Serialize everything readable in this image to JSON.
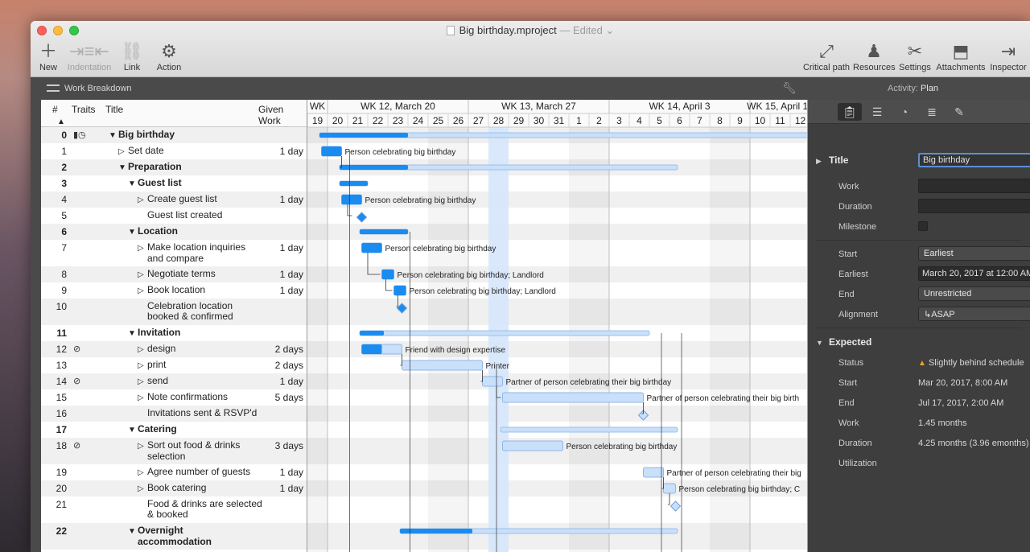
{
  "window": {
    "title": "Big birthday.mproject",
    "status": "— Edited"
  },
  "toolbar": {
    "left": [
      {
        "label": "New",
        "icon": "plus-icon"
      },
      {
        "label": "Indentation",
        "icon": "indentation-icon"
      },
      {
        "label": "Link",
        "icon": "link-icon"
      },
      {
        "label": "Action",
        "icon": "gear-icon"
      }
    ],
    "right": [
      {
        "label": "Critical path",
        "icon": "critical-path-icon"
      },
      {
        "label": "Resources",
        "icon": "resources-icon"
      },
      {
        "label": "Settings",
        "icon": "settings-icon"
      },
      {
        "label": "Attachments",
        "icon": "attachments-icon"
      },
      {
        "label": "Inspector",
        "icon": "inspector-icon"
      }
    ]
  },
  "subbar": {
    "view_label": "Work Breakdown",
    "activity_label": "Activity:",
    "activity_value": "Plan"
  },
  "outline": {
    "columns": {
      "num": "#",
      "traits": "Traits",
      "title": "Title",
      "work": "Given Work"
    },
    "rows": [
      {
        "num": "0",
        "title": "Big birthday",
        "work": "",
        "level": 0,
        "bold": true,
        "tri": "▼",
        "trait": "▮◷"
      },
      {
        "num": "1",
        "title": "Set date",
        "work": "1 day",
        "level": 1,
        "bold": false,
        "tri": "▷",
        "trait": ""
      },
      {
        "num": "2",
        "title": "Preparation",
        "work": "",
        "level": 1,
        "bold": true,
        "tri": "▼",
        "trait": ""
      },
      {
        "num": "3",
        "title": "Guest list",
        "work": "",
        "level": 2,
        "bold": true,
        "tri": "▼",
        "trait": ""
      },
      {
        "num": "4",
        "title": "Create guest list",
        "work": "1 day",
        "level": 3,
        "bold": false,
        "tri": "▷",
        "trait": ""
      },
      {
        "num": "5",
        "title": "Guest list created",
        "work": "",
        "level": 3,
        "bold": false,
        "tri": "",
        "trait": ""
      },
      {
        "num": "6",
        "title": "Location",
        "work": "",
        "level": 2,
        "bold": true,
        "tri": "▼",
        "trait": ""
      },
      {
        "num": "7",
        "title": "Make location inquiries",
        "title2": "and compare",
        "work": "1 day",
        "level": 3,
        "bold": false,
        "tri": "▷",
        "trait": ""
      },
      {
        "num": "8",
        "title": "Negotiate terms",
        "work": "1 day",
        "level": 3,
        "bold": false,
        "tri": "▷",
        "trait": ""
      },
      {
        "num": "9",
        "title": "Book location",
        "work": "1 day",
        "level": 3,
        "bold": false,
        "tri": "▷",
        "trait": ""
      },
      {
        "num": "10",
        "title": "Celebration location",
        "title2": "booked & confirmed",
        "work": "",
        "level": 3,
        "bold": false,
        "tri": "",
        "trait": ""
      },
      {
        "num": "11",
        "title": "Invitation",
        "work": "",
        "level": 2,
        "bold": true,
        "tri": "▼",
        "trait": ""
      },
      {
        "num": "12",
        "title": "design",
        "work": "2 days",
        "level": 3,
        "bold": false,
        "tri": "▷",
        "trait": "⊘"
      },
      {
        "num": "13",
        "title": "print",
        "work": "2 days",
        "level": 3,
        "bold": false,
        "tri": "▷",
        "trait": ""
      },
      {
        "num": "14",
        "title": "send",
        "work": "1 day",
        "level": 3,
        "bold": false,
        "tri": "▷",
        "trait": "⊘"
      },
      {
        "num": "15",
        "title": "Note confirmations",
        "work": "5 days",
        "level": 3,
        "bold": false,
        "tri": "▷",
        "trait": ""
      },
      {
        "num": "16",
        "title": "Invitations sent & RSVP'd",
        "work": "",
        "level": 3,
        "bold": false,
        "tri": "",
        "trait": ""
      },
      {
        "num": "17",
        "title": "Catering",
        "work": "",
        "level": 2,
        "bold": true,
        "tri": "▼",
        "trait": ""
      },
      {
        "num": "18",
        "title": "Sort out food & drinks",
        "title2": "selection",
        "work": "3 days",
        "level": 3,
        "bold": false,
        "tri": "▷",
        "trait": "⊘"
      },
      {
        "num": "19",
        "title": "Agree number of guests",
        "work": "1 day",
        "level": 3,
        "bold": false,
        "tri": "▷",
        "trait": ""
      },
      {
        "num": "20",
        "title": "Book catering",
        "work": "1 day",
        "level": 3,
        "bold": false,
        "tri": "▷",
        "trait": ""
      },
      {
        "num": "21",
        "title": "Food & drinks are selected",
        "title2": "& booked",
        "work": "",
        "level": 3,
        "bold": false,
        "tri": "",
        "trait": ""
      },
      {
        "num": "22",
        "title": "Overnight",
        "title2": "accommodation",
        "work": "",
        "level": 2,
        "bold": true,
        "tri": "▼",
        "trait": ""
      }
    ]
  },
  "gantt": {
    "weeks": [
      "WK",
      "WK 12, March 20",
      "WK 13, March 27",
      "WK 14, April 3",
      "WK 15, April 10"
    ],
    "days": [
      "19",
      "20",
      "21",
      "22",
      "23",
      "24",
      "25",
      "26",
      "27",
      "28",
      "29",
      "30",
      "31",
      "1",
      "2",
      "3",
      "4",
      "5",
      "6",
      "7",
      "8",
      "9",
      "10",
      "11",
      "12"
    ],
    "labels": [
      "Person celebrating big birthday",
      "Person celebrating big birthday",
      "Person celebrating big birthday",
      "Person celebrating big birthday; Landlord",
      "Person celebrating big birthday; Landlord",
      "Friend with design expertise",
      "Printer",
      "Partner of person celebrating their big birthday",
      "Partner of person celebrating their big birth",
      "Person celebrating big birthday",
      "Partner of person celebrating their big",
      "Person celebrating big birthday; C"
    ]
  },
  "inspector": {
    "title_label": "Title",
    "title_value": "Big birthday",
    "work_label": "Work",
    "duration_label": "Duration",
    "milestone_label": "Milestone",
    "start_label": "Start",
    "start_value": "Earliest",
    "earliest_label": "Earliest",
    "earliest_value": "March 20, 2017 at 12:00 AM",
    "end_label": "End",
    "end_value": "Unrestricted",
    "alignment_label": "Alignment",
    "alignment_value": "↳ASAP",
    "expected_label": "Expected",
    "status_label": "Status",
    "status_value": "Slightly behind schedule",
    "exp_start_label": "Start",
    "exp_start_value": "Mar 20, 2017, 8:00 AM",
    "exp_end_label": "End",
    "exp_end_value": "Jul 17, 2017, 2:00 AM",
    "exp_work_label": "Work",
    "exp_work_value": "1.45 months",
    "exp_duration_label": "Duration",
    "exp_duration_value": "4.25 months (3.96 emonths)",
    "utilization_label": "Utilization"
  },
  "colors": {
    "bar": "#1a8cf0",
    "bar_light": "#c9dffa",
    "dark_panel": "#3e3e3e"
  }
}
